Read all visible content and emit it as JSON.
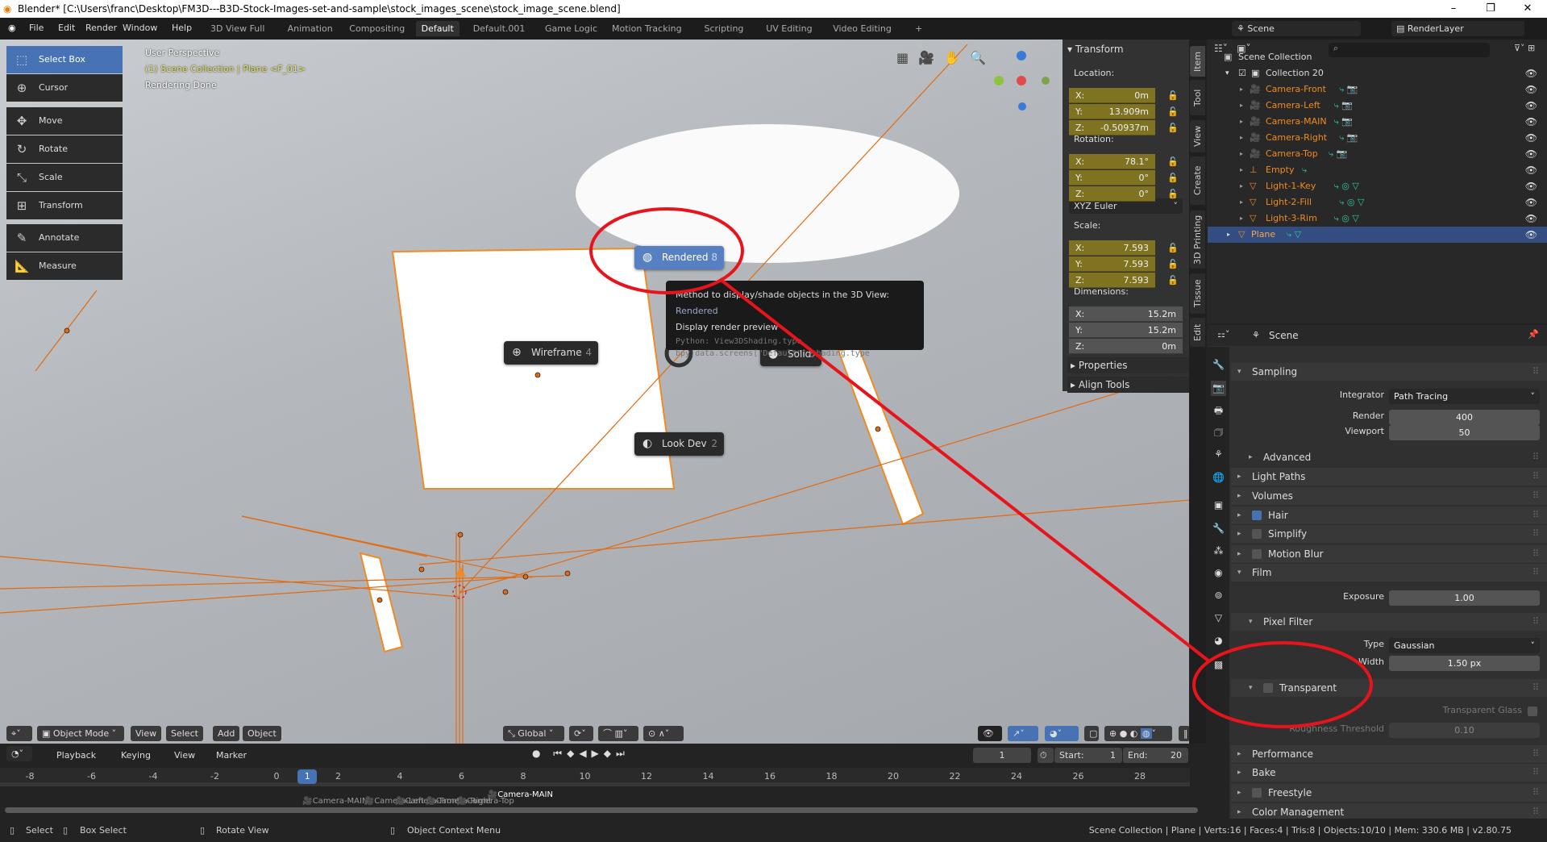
{
  "window": {
    "title": "Blender* [C:\\Users\\franc\\Desktop\\FM3D---B3D-Stock-Images-set-and-sample\\stock_images_scene\\stock_image_scene.blend]",
    "minimize": "–",
    "maximize": "❐",
    "close": "✕"
  },
  "menu": [
    "File",
    "Edit",
    "Render",
    "Window",
    "Help"
  ],
  "workspaces": [
    "3D View Full",
    "Animation",
    "Compositing",
    "Default",
    "Default.001",
    "Game Logic",
    "Motion Tracking",
    "Scripting",
    "UV Editing",
    "Video Editing",
    "+"
  ],
  "active_workspace": "Default",
  "scene_name": "Scene",
  "view_layer": "RenderLayer",
  "tools": [
    {
      "label": "Select Box",
      "icon": "select-box-icon",
      "glyph": "⬚"
    },
    {
      "label": "Cursor",
      "icon": "cursor-icon",
      "glyph": "⊕"
    },
    {
      "label": "Move",
      "icon": "move-icon",
      "glyph": "✥"
    },
    {
      "label": "Rotate",
      "icon": "rotate-icon",
      "glyph": "↻"
    },
    {
      "label": "Scale",
      "icon": "scale-icon",
      "glyph": "⤡"
    },
    {
      "label": "Transform",
      "icon": "transform-icon",
      "glyph": "⊞"
    },
    {
      "label": "Annotate",
      "icon": "annotate-icon",
      "glyph": "✎"
    },
    {
      "label": "Measure",
      "icon": "measure-icon",
      "glyph": "📐"
    }
  ],
  "overlay": {
    "perspective": "User Perspective",
    "collection": "(1) Scene Collection | Plane <F_01>",
    "status": "Rendering Done"
  },
  "pie": {
    "rendered": {
      "label": "Rendered",
      "key": "8"
    },
    "wireframe": {
      "label": "Wireframe",
      "key": "4"
    },
    "solid": {
      "label": "Solid",
      "key": "6"
    },
    "lookdev": {
      "label": "Look Dev",
      "key": "2"
    }
  },
  "tooltip": {
    "line1": "Method to display/shade objects in the 3D View:",
    "value": "Rendered",
    "line2": "Display render preview",
    "python1": "Python: View3DShading.type",
    "python2": "bpy.data.screens[\"Default\"].shading.type"
  },
  "viewport_header": {
    "mode": "Object Mode",
    "menus": [
      "View",
      "Select",
      "Add",
      "Object"
    ],
    "orientation": "Global"
  },
  "npanel": {
    "title": "Transform",
    "location_label": "Location:",
    "location": [
      {
        "axis": "X:",
        "value": "0m"
      },
      {
        "axis": "Y:",
        "value": "13.909m"
      },
      {
        "axis": "Z:",
        "value": "-0.50937m"
      }
    ],
    "rotation_label": "Rotation:",
    "rotation": [
      {
        "axis": "X:",
        "value": "78.1°"
      },
      {
        "axis": "Y:",
        "value": "0°"
      },
      {
        "axis": "Z:",
        "value": "0°"
      }
    ],
    "rotation_mode": "XYZ Euler",
    "scale_label": "Scale:",
    "scale": [
      {
        "axis": "X:",
        "value": "7.593"
      },
      {
        "axis": "Y:",
        "value": "7.593"
      },
      {
        "axis": "Z:",
        "value": "7.593"
      }
    ],
    "dimensions_label": "Dimensions:",
    "dimensions": [
      {
        "axis": "X:",
        "value": "15.2m"
      },
      {
        "axis": "Y:",
        "value": "15.2m"
      },
      {
        "axis": "Z:",
        "value": "0m"
      }
    ],
    "properties": "Properties",
    "align_tools": "Align Tools",
    "tabs": [
      "Item",
      "Tool",
      "View",
      "Create",
      "3D Printing",
      "Tissue",
      "Edit"
    ]
  },
  "outliner": {
    "root": "Scene Collection",
    "collection": "Collection 20",
    "items": [
      {
        "name": "Camera-Front",
        "type": "camera"
      },
      {
        "name": "Camera-Left",
        "type": "camera"
      },
      {
        "name": "Camera-MAIN",
        "type": "camera"
      },
      {
        "name": "Camera-Right",
        "type": "camera"
      },
      {
        "name": "Camera-Top",
        "type": "camera"
      },
      {
        "name": "Empty",
        "type": "empty"
      },
      {
        "name": "Light-1-Key",
        "type": "mesh"
      },
      {
        "name": "Light-2-Fill",
        "type": "mesh"
      },
      {
        "name": "Light-3-Rim",
        "type": "mesh"
      }
    ],
    "selected": "Plane"
  },
  "properties": {
    "context": "Scene",
    "sampling": "Sampling",
    "integrator_label": "Integrator",
    "integrator": "Path Tracing",
    "render_label": "Render",
    "render": "400",
    "viewport_label": "Viewport",
    "viewport": "50",
    "advanced": "Advanced",
    "light_paths": "Light Paths",
    "volumes": "Volumes",
    "hair": "Hair",
    "hair_on": true,
    "simplify": "Simplify",
    "motion_blur": "Motion Blur",
    "film": "Film",
    "exposure_label": "Exposure",
    "exposure": "1.00",
    "pixel_filter": "Pixel Filter",
    "type_label": "Type",
    "type": "Gaussian",
    "width_label": "Width",
    "width": "1.50 px",
    "transparent": "Transparent",
    "transparent_glass": "Transparent Glass",
    "roughness_label": "Roughness Threshold",
    "roughness": "0.10",
    "performance": "Performance",
    "bake": "Bake",
    "freestyle": "Freestyle",
    "color_management": "Color Management"
  },
  "timeline": {
    "menus": [
      "Playback",
      "Keying",
      "View",
      "Marker"
    ],
    "current_frame": "1",
    "start_label": "Start:",
    "start": "1",
    "end_label": "End:",
    "end": "20",
    "ticks": [
      -8,
      -6,
      -4,
      -2,
      0,
      2,
      4,
      6,
      8,
      10,
      12,
      14,
      16,
      18,
      20,
      22,
      24,
      26,
      28
    ],
    "markers": [
      {
        "frame": 1,
        "name": "Camera-MAIN"
      },
      {
        "frame": 3,
        "name": "Camera-Left"
      },
      {
        "frame": 4,
        "name": "Camera-Front"
      },
      {
        "frame": 5,
        "name": "Camera-Right"
      },
      {
        "frame": 6,
        "name": "Camera-Top"
      },
      {
        "frame": 7,
        "name": "Camera-MAIN"
      }
    ]
  },
  "statusbar": {
    "select": "Select",
    "box_select": "Box Select",
    "rotate_view": "Rotate View",
    "context_menu": "Object Context Menu",
    "stats": "Scene Collection | Plane | Verts:16 | Faces:4 | Tris:8 | Objects:10/10 | Mem: 330.6 MB | v2.80.75"
  },
  "colors": {
    "accent": "#4772b3",
    "selected_object": "#f08a24",
    "annotation": "#e8141c",
    "field_yellow": "#7f7322"
  }
}
